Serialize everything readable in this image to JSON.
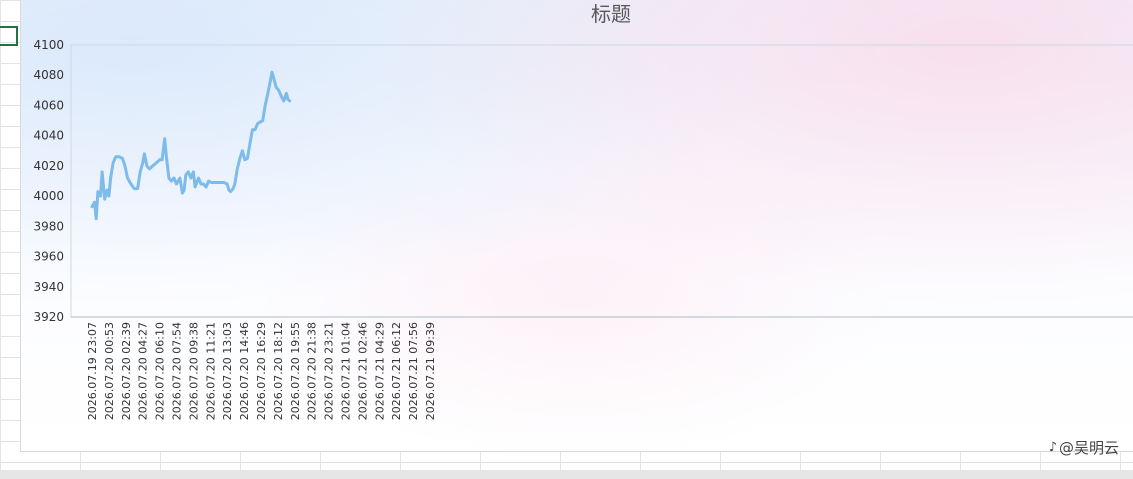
{
  "chart_data": {
    "type": "line",
    "title": "标题",
    "ylim": [
      3920,
      4100
    ],
    "y_ticks": [
      "3920",
      "3940",
      "3960",
      "3980",
      "4000",
      "4020",
      "4040",
      "4060",
      "4080",
      "4100"
    ],
    "x_tick_labels": [
      "2026.07.19 23:07",
      "2026.07.20 00:53",
      "2026.07.20 02:39",
      "2026.07.20 04:27",
      "2026.07.20 06:10",
      "2026.07.20 07:54",
      "2026.07.20 09:38",
      "2026.07.20 11:21",
      "2026.07.20 13:03",
      "2026.07.20 14:46",
      "2026.07.20 16:29",
      "2026.07.20 18:12",
      "2026.07.20 19:55",
      "2026.07.20 21:38",
      "2026.07.20 23:21",
      "2026.07.21 01:04",
      "2026.07.21 02:46",
      "2026.07.21 04:29",
      "2026.07.21 06:12",
      "2026.07.21 07:56",
      "2026.07.21 09:39"
    ],
    "series": [
      {
        "color": "#7dbbeb",
        "values": [
          [
            0,
            3993
          ],
          [
            0.15,
            3996
          ],
          [
            0.25,
            3985
          ],
          [
            0.35,
            4003
          ],
          [
            0.5,
            4000
          ],
          [
            0.6,
            4016
          ],
          [
            0.75,
            3998
          ],
          [
            0.9,
            4004
          ],
          [
            1.0,
            4000
          ],
          [
            1.1,
            4012
          ],
          [
            1.25,
            4022
          ],
          [
            1.4,
            4026
          ],
          [
            1.6,
            4026
          ],
          [
            1.8,
            4025
          ],
          [
            1.95,
            4020
          ],
          [
            2.1,
            4012
          ],
          [
            2.3,
            4008
          ],
          [
            2.5,
            4005
          ],
          [
            2.7,
            4005
          ],
          [
            2.85,
            4016
          ],
          [
            3.0,
            4022
          ],
          [
            3.1,
            4028
          ],
          [
            3.25,
            4020
          ],
          [
            3.4,
            4018
          ],
          [
            3.6,
            4020
          ],
          [
            3.8,
            4022
          ],
          [
            4.0,
            4024
          ],
          [
            4.15,
            4024
          ],
          [
            4.3,
            4038
          ],
          [
            4.4,
            4026
          ],
          [
            4.55,
            4012
          ],
          [
            4.7,
            4010
          ],
          [
            4.85,
            4012
          ],
          [
            5.0,
            4008
          ],
          [
            5.2,
            4012
          ],
          [
            5.35,
            4002
          ],
          [
            5.45,
            4004
          ],
          [
            5.55,
            4014
          ],
          [
            5.7,
            4016
          ],
          [
            5.85,
            4012
          ],
          [
            6.0,
            4016
          ],
          [
            6.1,
            4006
          ],
          [
            6.3,
            4012
          ],
          [
            6.45,
            4008
          ],
          [
            6.6,
            4008
          ],
          [
            6.75,
            4006
          ],
          [
            6.9,
            4010
          ],
          [
            7.05,
            4009
          ],
          [
            7.3,
            4009
          ],
          [
            7.55,
            4009
          ],
          [
            7.8,
            4009
          ],
          [
            8.0,
            4008
          ],
          [
            8.1,
            4004
          ],
          [
            8.2,
            4003
          ],
          [
            8.35,
            4005
          ],
          [
            8.45,
            4008
          ],
          [
            8.6,
            4018
          ],
          [
            8.75,
            4025
          ],
          [
            8.9,
            4030
          ],
          [
            9.05,
            4024
          ],
          [
            9.2,
            4025
          ],
          [
            9.35,
            4035
          ],
          [
            9.5,
            4044
          ],
          [
            9.65,
            4044
          ],
          [
            9.8,
            4048
          ],
          [
            9.95,
            4049
          ],
          [
            10.1,
            4050
          ],
          [
            10.25,
            4060
          ],
          [
            10.4,
            4068
          ],
          [
            10.55,
            4076
          ],
          [
            10.65,
            4082
          ],
          [
            10.75,
            4078
          ],
          [
            10.9,
            4072
          ],
          [
            11.05,
            4070
          ],
          [
            11.2,
            4066
          ],
          [
            11.35,
            4063
          ],
          [
            11.5,
            4068
          ],
          [
            11.6,
            4064
          ],
          [
            11.7,
            4063
          ]
        ]
      }
    ]
  },
  "watermark": {
    "text": "@吴明云",
    "icon": "douyin-logo-icon"
  },
  "colors": {
    "line": "#7dbbeb",
    "cell_cursor": "#217346"
  }
}
